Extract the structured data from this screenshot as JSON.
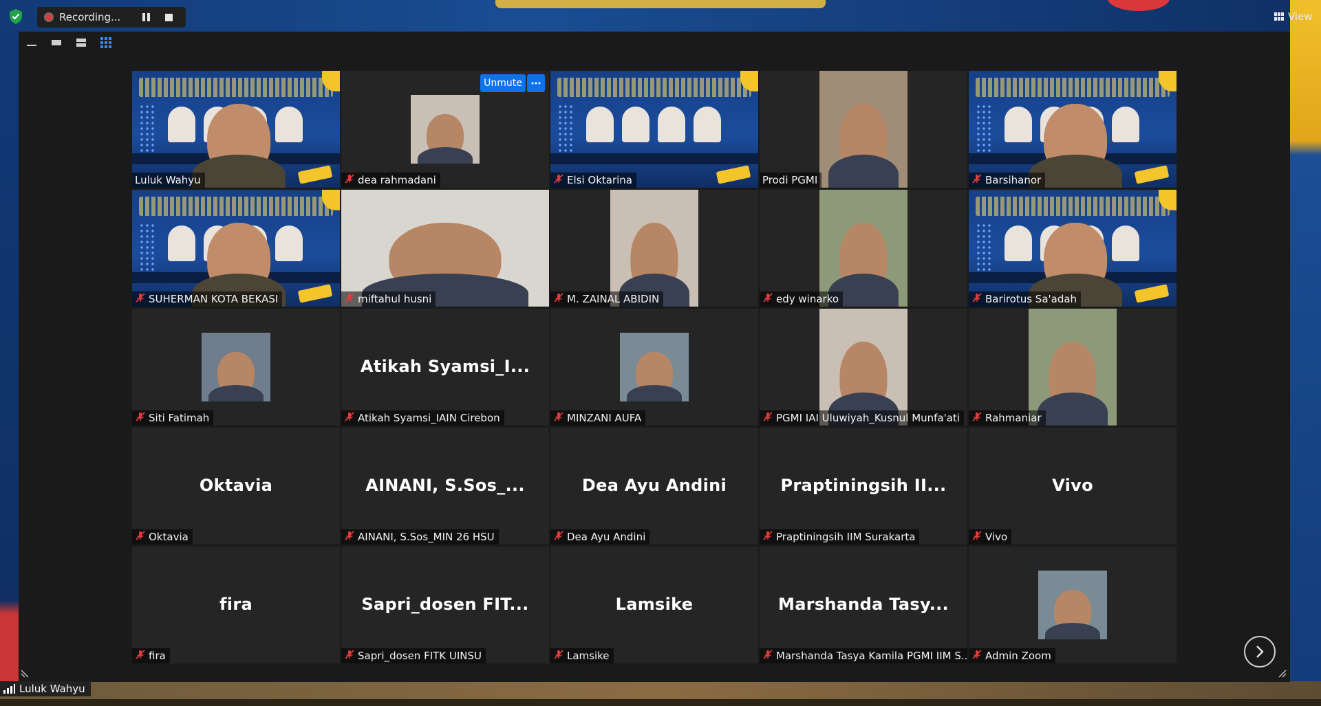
{
  "recording": {
    "label": "Recording..."
  },
  "view_button": {
    "label": "View"
  },
  "speaker": {
    "name": "Luluk Wahyu"
  },
  "colors": {
    "active_border": "#b6e23a",
    "button_blue": "#0e72ed",
    "tile_bg": "#252525",
    "window_bg": "#1a1a1a"
  },
  "tile_menu": {
    "unmute_label": "Unmute",
    "more_icon": "ellipsis-icon"
  },
  "participants": [
    {
      "name": "Luluk Wahyu",
      "display": "",
      "muted": false,
      "video": "poster-cam",
      "active": true
    },
    {
      "name": "dea rahmadani",
      "display": "",
      "muted": true,
      "video": "avatar",
      "active": false
    },
    {
      "name": "Elsi Oktarina",
      "display": "",
      "muted": true,
      "video": "poster",
      "active": false
    },
    {
      "name": "Prodi PGMI",
      "display": "",
      "muted": false,
      "video": "cam",
      "active": false
    },
    {
      "name": "Barsihanor",
      "display": "",
      "muted": true,
      "video": "poster-cam",
      "active": false
    },
    {
      "name": "SUHERMAN KOTA BEKASI",
      "display": "",
      "muted": true,
      "video": "poster-cam",
      "active": false
    },
    {
      "name": "miftahul husni",
      "display": "",
      "muted": true,
      "video": "cam",
      "active": false
    },
    {
      "name": "M. ZAINAL ABIDIN",
      "display": "",
      "muted": true,
      "video": "cam",
      "active": false
    },
    {
      "name": "edy winarko",
      "display": "",
      "muted": true,
      "video": "cam",
      "active": false
    },
    {
      "name": "Barirotus Sa'adah",
      "display": "",
      "muted": true,
      "video": "poster-cam",
      "active": false
    },
    {
      "name": "Siti Fatimah",
      "display": "",
      "muted": true,
      "video": "avatar",
      "active": false
    },
    {
      "name": "Atikah Syamsi_IAIN Cirebon",
      "display": "Atikah  Syamsi_I...",
      "muted": true,
      "video": "none",
      "active": false
    },
    {
      "name": "MINZANI AUFA",
      "display": "",
      "muted": true,
      "video": "avatar",
      "active": false
    },
    {
      "name": "PGMI IAI Uluwiyah_Kusnul Munfa'ati",
      "display": "",
      "muted": true,
      "video": "cam",
      "active": false
    },
    {
      "name": "Rahmaniar",
      "display": "",
      "muted": true,
      "video": "cam",
      "active": false
    },
    {
      "name": "Oktavia",
      "display": "Oktavia",
      "muted": true,
      "video": "none",
      "active": false
    },
    {
      "name": "AINANI, S.Sos_MIN 26 HSU",
      "display": "AINANI,  S.Sos_...",
      "muted": true,
      "video": "none",
      "active": false
    },
    {
      "name": "Dea Ayu Andini",
      "display": "Dea Ayu Andini",
      "muted": true,
      "video": "none",
      "active": false
    },
    {
      "name": "Praptiningsih IIM Surakarta",
      "display": "Praptiningsih  II...",
      "muted": true,
      "video": "none",
      "active": false
    },
    {
      "name": "Vivo",
      "display": "Vivo",
      "muted": true,
      "video": "none",
      "active": false
    },
    {
      "name": "fira",
      "display": "fira",
      "muted": true,
      "video": "none",
      "active": false
    },
    {
      "name": "Sapri_dosen FITK UINSU",
      "display": "Sapri_dosen  FIT...",
      "muted": true,
      "video": "none",
      "active": false
    },
    {
      "name": "Lamsike",
      "display": "Lamsike",
      "muted": true,
      "video": "none",
      "active": false
    },
    {
      "name": "Marshanda Tasya Kamila PGMI IIM S...",
      "display": "Marshanda  Tasy...",
      "muted": true,
      "video": "none",
      "active": false
    },
    {
      "name": "Admin Zoom",
      "display": "",
      "muted": true,
      "video": "avatar",
      "active": false
    }
  ]
}
